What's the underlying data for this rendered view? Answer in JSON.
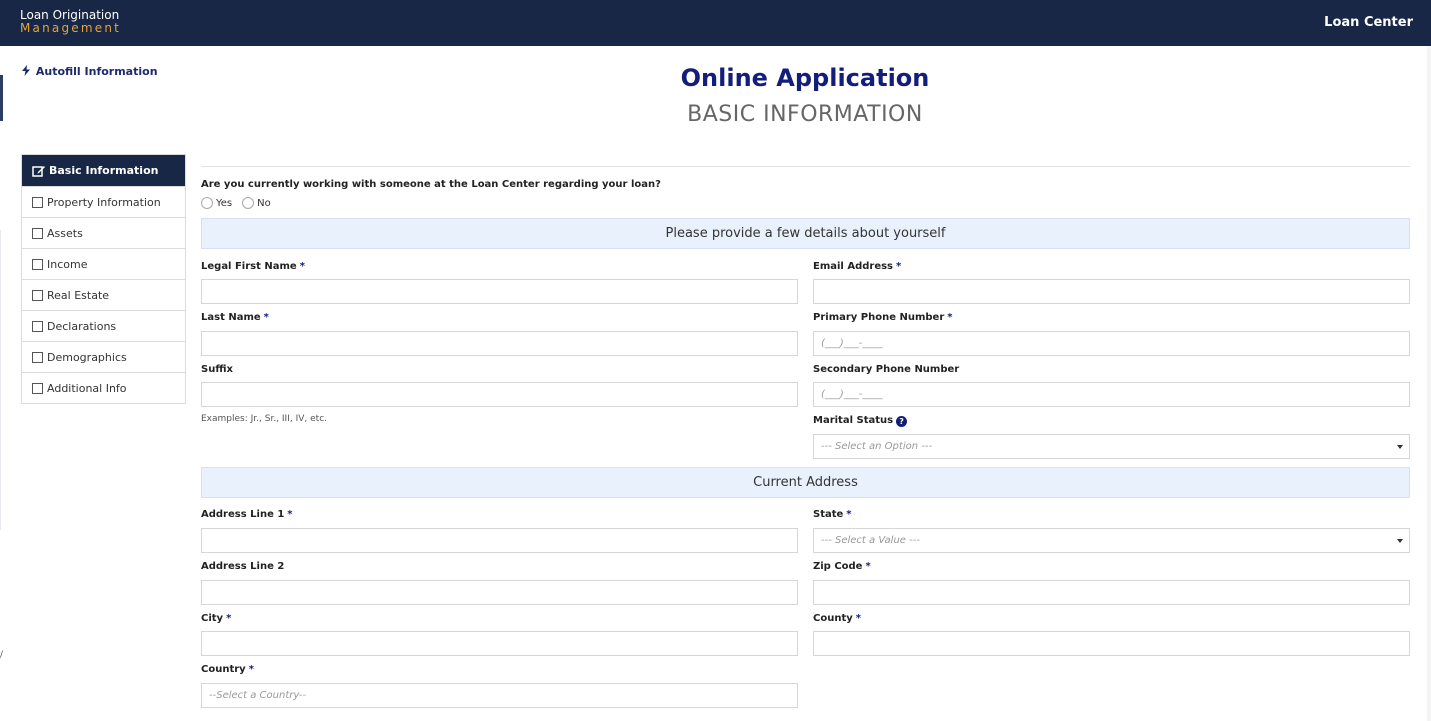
{
  "header": {
    "brand_line1": "Loan Origination",
    "brand_line2": "Management",
    "right_label": "Loan Center"
  },
  "autofill": {
    "label": "Autofill Information"
  },
  "page": {
    "title": "Online Application",
    "subtitle": "BASIC INFORMATION"
  },
  "sidebar": {
    "items": [
      {
        "label": "Basic Information",
        "active": true
      },
      {
        "label": "Property Information"
      },
      {
        "label": "Assets"
      },
      {
        "label": "Income"
      },
      {
        "label": "Real Estate"
      },
      {
        "label": "Declarations"
      },
      {
        "label": "Demographics"
      },
      {
        "label": "Additional Info"
      }
    ]
  },
  "question": {
    "text": "Are you currently working with someone at the Loan Center regarding your loan?",
    "yes": "Yes",
    "no": "No"
  },
  "sections": {
    "about": "Please provide a few details about yourself",
    "address": "Current Address"
  },
  "fields": {
    "first_name": {
      "label": "Legal First Name",
      "value": ""
    },
    "last_name": {
      "label": "Last Name",
      "value": ""
    },
    "suffix": {
      "label": "Suffix",
      "value": "",
      "help": "Examples: Jr., Sr., III, IV, etc."
    },
    "email": {
      "label": "Email Address",
      "value": ""
    },
    "primary_phone": {
      "label": "Primary Phone Number",
      "placeholder": "(___)___-____"
    },
    "secondary_phone": {
      "label": "Secondary Phone Number",
      "placeholder": "(___)___-____"
    },
    "marital_status": {
      "label": "Marital Status",
      "selected": "--- Select an Option ---"
    },
    "address1": {
      "label": "Address Line 1",
      "value": ""
    },
    "address2": {
      "label": "Address Line 2",
      "value": ""
    },
    "city": {
      "label": "City",
      "value": ""
    },
    "country": {
      "label": "Country",
      "selected": "--Select a Country--"
    },
    "state": {
      "label": "State",
      "selected": "--- Select a Value ---"
    },
    "zip": {
      "label": "Zip Code",
      "value": ""
    },
    "county": {
      "label": "County",
      "value": ""
    }
  },
  "required_mark": "*",
  "colors": {
    "navbar": "#172745",
    "brand_accent": "#e7a23c",
    "title": "#131e7a",
    "section_bg": "#e8f1fc"
  }
}
